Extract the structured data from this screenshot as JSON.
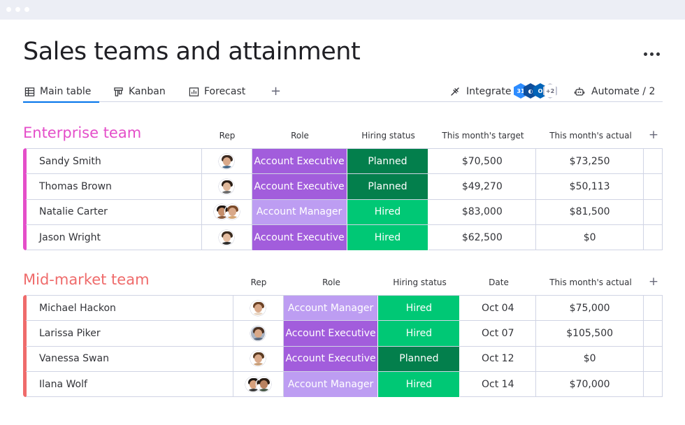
{
  "page": {
    "title": "Sales teams and attainment"
  },
  "tabs": [
    {
      "label": "Main table",
      "icon": "table-icon",
      "active": true
    },
    {
      "label": "Kanban",
      "icon": "kanban-icon",
      "active": false
    },
    {
      "label": "Forecast",
      "icon": "chart-icon",
      "active": false
    }
  ],
  "toolbar": {
    "integrate_label": "Integrate",
    "integrations_more": "+2",
    "automate_label": "Automate / 2"
  },
  "colors": {
    "enterprise_title": "#e44ec9",
    "midmarket_title": "#ef6b6b",
    "enterprise_stripe": "#e44ec9",
    "midmarket_stripe": "#ef6b6b",
    "account_executive": "#a25ddc",
    "account_manager": "#bd9df2",
    "planned": "#037f4c",
    "hired": "#00c875"
  },
  "groups": {
    "enterprise": {
      "title": "Enterprise team",
      "columns": [
        "Rep",
        "Role",
        "Hiring status",
        "This month's target",
        "This month's actual"
      ],
      "rows": [
        {
          "name": "Sandy Smith",
          "role": "Account Executive",
          "status": "Planned",
          "target": "$70,500",
          "actual": "$73,250"
        },
        {
          "name": "Thomas Brown",
          "role": "Account Executive",
          "status": "Planned",
          "target": "$49,270",
          "actual": "$50,113"
        },
        {
          "name": "Natalie Carter",
          "role": "Account Manager",
          "status": "Hired",
          "target": "$83,000",
          "actual": "$81,500"
        },
        {
          "name": "Jason Wright",
          "role": "Account Executive",
          "status": "Hired",
          "target": "$62,500",
          "actual": "$0"
        }
      ]
    },
    "midmarket": {
      "title": "Mid-market team",
      "columns": [
        "Rep",
        "Role",
        "Hiring status",
        "Date",
        "This month's actual"
      ],
      "rows": [
        {
          "name": "Michael Hackon",
          "role": "Account Manager",
          "status": "Hired",
          "date": "Oct 04",
          "actual": "$75,000"
        },
        {
          "name": "Larissa Piker",
          "role": "Account Executive",
          "status": "Hired",
          "date": "Oct 07",
          "actual": "$105,500"
        },
        {
          "name": "Vanessa Swan",
          "role": "Account Executive",
          "status": "Planned",
          "date": "Oct 12",
          "actual": "$0"
        },
        {
          "name": "Ilana Wolf",
          "role": "Account Manager",
          "status": "Hired",
          "date": "Oct 14",
          "actual": "$70,000"
        }
      ]
    }
  }
}
